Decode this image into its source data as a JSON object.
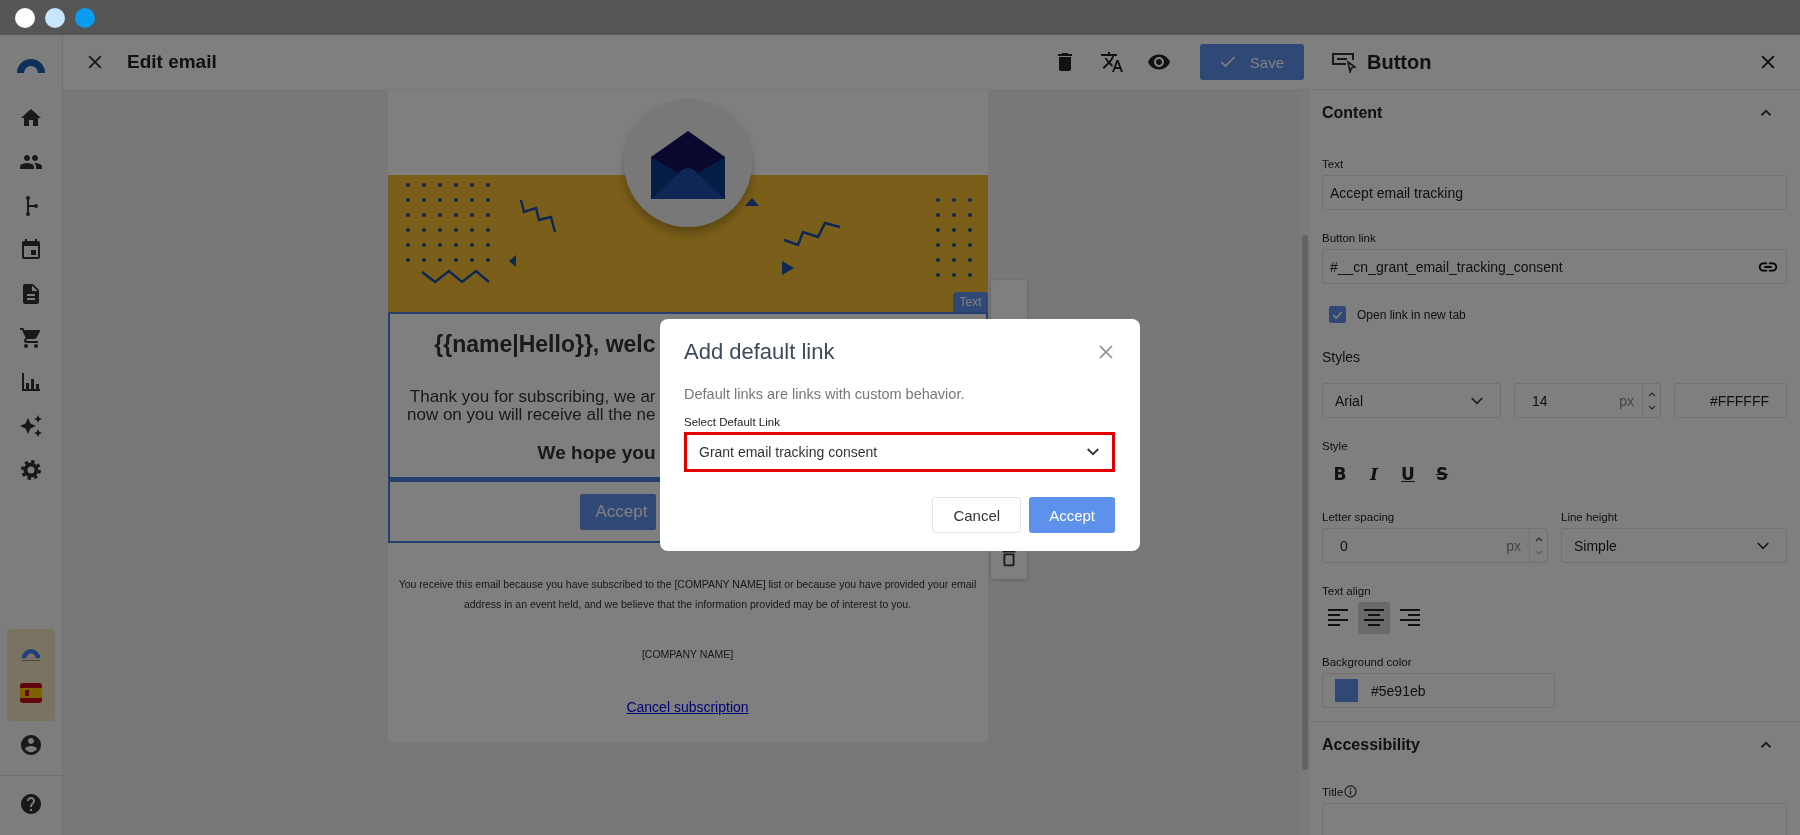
{
  "header": {
    "title": "Edit email",
    "save_button": "Save"
  },
  "email": {
    "badge": "Text",
    "heading": "{{name|Hello}}, welc",
    "paragraph_lines": [
      "Thank you for subscribing, we ar",
      "now on you will receive all the ne"
    ],
    "closing": "We hope you",
    "button": "Accept",
    "footer": "You receive this email because you have subscribed to the [COMPANY NAME] list or because you have provided your email address in an event held, and we believe that the information provided may be of interest to you.",
    "company": "[COMPANY NAME]",
    "unsubscribe": "Cancel subscription"
  },
  "panel": {
    "title": "Button",
    "content": {
      "heading": "Content",
      "expanded": true,
      "text_label": "Text",
      "text_value": "Accept email tracking",
      "link_label": "Button link",
      "link_value": "#__cn_grant_email_tracking_consent",
      "new_tab": {
        "label": "Open link in new tab",
        "checked": true
      },
      "styles_label": "Styles",
      "font": "Arial",
      "font_size": "14",
      "font_size_unit": "px",
      "text_color": "#FFFFFF",
      "style_label": "Style",
      "format_buttons": [
        {
          "glyph": "B",
          "kind": "bold"
        },
        {
          "glyph": "I",
          "kind": "italic"
        },
        {
          "glyph": "U",
          "kind": "underline"
        },
        {
          "glyph": "S",
          "kind": "strike"
        }
      ],
      "letter_spacing_label": "Letter spacing",
      "letter_spacing": "0",
      "letter_spacing_unit": "px",
      "line_height_label": "Line height",
      "line_height": "Simple",
      "align_label": "Text align",
      "alignments": [
        {
          "kind": "left",
          "selected": false
        },
        {
          "kind": "center",
          "selected": true
        },
        {
          "kind": "right",
          "selected": false
        }
      ],
      "background": {
        "label": "Background color",
        "value": "#5e91eb"
      }
    },
    "accessibility": {
      "heading": "Accessibility",
      "expanded": true,
      "title_label": "Title"
    }
  },
  "dialog": {
    "title": "Add default link",
    "description": "Default links are links with custom behavior.",
    "select_label": "Select Default Link",
    "select_value": "Grant email tracking consent",
    "buttons": [
      {
        "label": "Cancel",
        "kind": "secondary"
      },
      {
        "label": "Accept",
        "kind": "primary"
      }
    ]
  }
}
